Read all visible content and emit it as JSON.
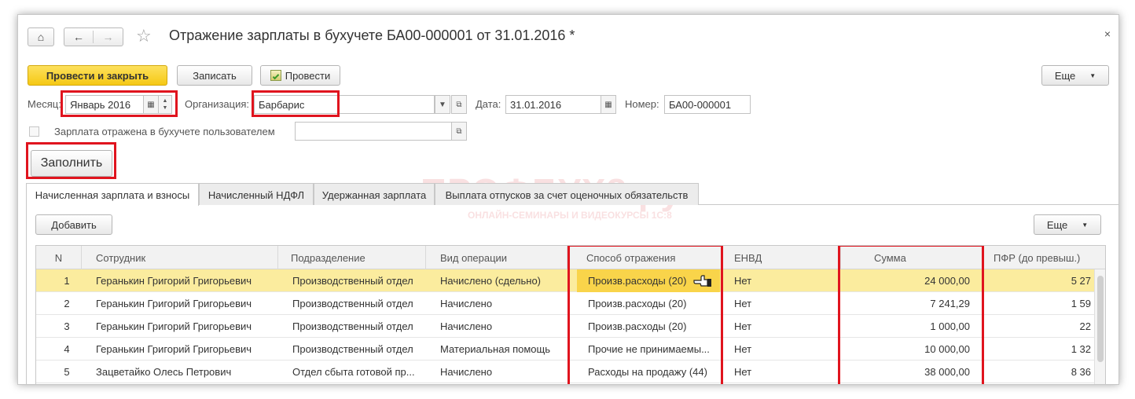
{
  "window": {
    "title": "Отражение зарплаты в бухучете БА00-000001 от 31.01.2016 *",
    "close_glyph": "×",
    "home_icon": "⌂",
    "back_icon": "←",
    "forward_icon": "→",
    "star_icon": "☆"
  },
  "toolbar": {
    "post_close": "Провести и закрыть",
    "save": "Записать",
    "post": "Провести",
    "more": "Еще",
    "more_arrow": "▼"
  },
  "form": {
    "month_label": "Месяц:",
    "month_value": "Январь 2016",
    "org_label": "Организация:",
    "org_value": "Барбарис",
    "date_label": "Дата:",
    "date_value": "31.01.2016",
    "number_label": "Номер:",
    "number_value": "БА00-000001",
    "reflected_label": "Зарплата отражена в бухучете пользователем",
    "fill_button": "Заполнить"
  },
  "watermark": {
    "brand": "ПРОФБУХ8.ру",
    "tagline": "ОНЛАЙН-СЕМИНАРЫ И ВИДЕОКУРСЫ 1С:8"
  },
  "tabs": [
    {
      "label": "Начисленная зарплата и взносы"
    },
    {
      "label": "Начисленный НДФЛ"
    },
    {
      "label": "Удержанная зарплата"
    },
    {
      "label": "Выплата отпусков за счет оценочных обязательств"
    }
  ],
  "table_toolbar": {
    "add": "Добавить",
    "more": "Еще",
    "more_arrow": "▼"
  },
  "table": {
    "headers": [
      "N",
      "Сотрудник",
      "Подразделение",
      "Вид операции",
      "Способ отражения",
      "ЕНВД",
      "Сумма",
      "ПФР (до превыш.)"
    ],
    "rows": [
      {
        "n": "1",
        "employee": "Геранькин Григорий Григорьевич",
        "department": "Производственный отдел",
        "operation": "Начислено (сдельно)",
        "method": "Произв.расходы (20)",
        "envd": "Нет",
        "sum": "24 000,00",
        "pfr": "5 27"
      },
      {
        "n": "2",
        "employee": "Геранькин Григорий Григорьевич",
        "department": "Производственный отдел",
        "operation": "Начислено",
        "method": "Произв.расходы (20)",
        "envd": "Нет",
        "sum": "7 241,29",
        "pfr": "1 59"
      },
      {
        "n": "3",
        "employee": "Геранькин Григорий Григорьевич",
        "department": "Производственный отдел",
        "operation": "Начислено",
        "method": "Произв.расходы (20)",
        "envd": "Нет",
        "sum": "1 000,00",
        "pfr": "22"
      },
      {
        "n": "4",
        "employee": "Геранькин Григорий Григорьевич",
        "department": "Производственный отдел",
        "operation": "Материальная помощь",
        "method": "Прочие не принимаемы...",
        "envd": "Нет",
        "sum": "10 000,00",
        "pfr": "1 32"
      },
      {
        "n": "5",
        "employee": "Зацветайко Олесь Петрович",
        "department": "Отдел сбыта готовой пр...",
        "operation": "Начислено",
        "method": "Расходы на продажу (44)",
        "envd": "Нет",
        "sum": "38 000,00",
        "pfr": "8 36"
      }
    ]
  },
  "colors": {
    "highlight": "#e0141e",
    "primary_button": "#f5c814",
    "selected_row": "#fbec9e"
  }
}
